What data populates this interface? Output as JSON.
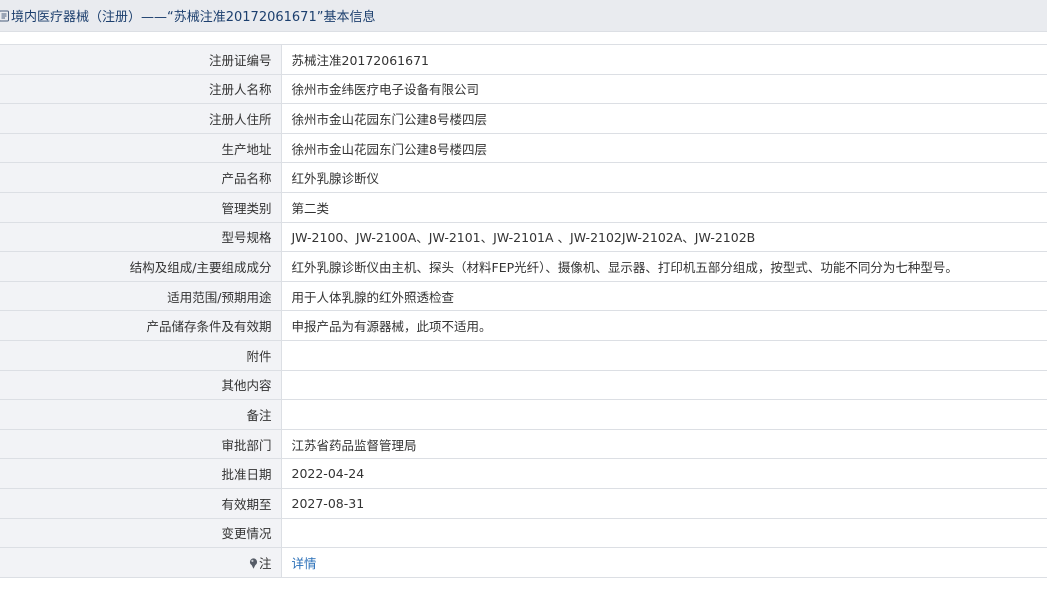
{
  "header": {
    "icon": "document-icon",
    "title": "境内医疗器械（注册）——“苏械注准20172061671”基本信息"
  },
  "rows": [
    {
      "key": "registration-number",
      "label": "注册证编号",
      "value": "苏械注准20172061671"
    },
    {
      "key": "registrant-name",
      "label": "注册人名称",
      "value": "徐州市金纬医疗电子设备有限公司"
    },
    {
      "key": "registrant-address",
      "label": "注册人住所",
      "value": "徐州市金山花园东门公建8号楼四层"
    },
    {
      "key": "production-address",
      "label": "生产地址",
      "value": "徐州市金山花园东门公建8号楼四层"
    },
    {
      "key": "product-name",
      "label": "产品名称",
      "value": "红外乳腺诊断仪"
    },
    {
      "key": "management-category",
      "label": "管理类别",
      "value": "第二类"
    },
    {
      "key": "model-spec",
      "label": "型号规格",
      "value": "JW-2100、JW-2100A、JW-2101、JW-2101A 、JW-2102JW-2102A、JW-2102B"
    },
    {
      "key": "structure-composition",
      "label": "结构及组成/主要组成成分",
      "value": "红外乳腺诊断仪由主机、探头（材料FEP光纤）、摄像机、显示器、打印机五部分组成，按型式、功能不同分为七种型号。"
    },
    {
      "key": "intended-use",
      "label": "适用范围/预期用途",
      "value": "用于人体乳腺的红外照透检查"
    },
    {
      "key": "storage-validity",
      "label": "产品储存条件及有效期",
      "value": "申报产品为有源器械，此项不适用。"
    },
    {
      "key": "attachment",
      "label": "附件",
      "value": ""
    },
    {
      "key": "other-content",
      "label": "其他内容",
      "value": ""
    },
    {
      "key": "remarks",
      "label": "备注",
      "value": ""
    },
    {
      "key": "approval-department",
      "label": "审批部门",
      "value": "江苏省药品监督管理局"
    },
    {
      "key": "approval-date",
      "label": "批准日期",
      "value": "2022-04-24"
    },
    {
      "key": "valid-until",
      "label": "有效期至",
      "value": "2027-08-31"
    },
    {
      "key": "change-status",
      "label": "变更情况",
      "value": ""
    }
  ],
  "note_row": {
    "icon": "pin-icon",
    "label": "注",
    "link_text": "详情"
  }
}
